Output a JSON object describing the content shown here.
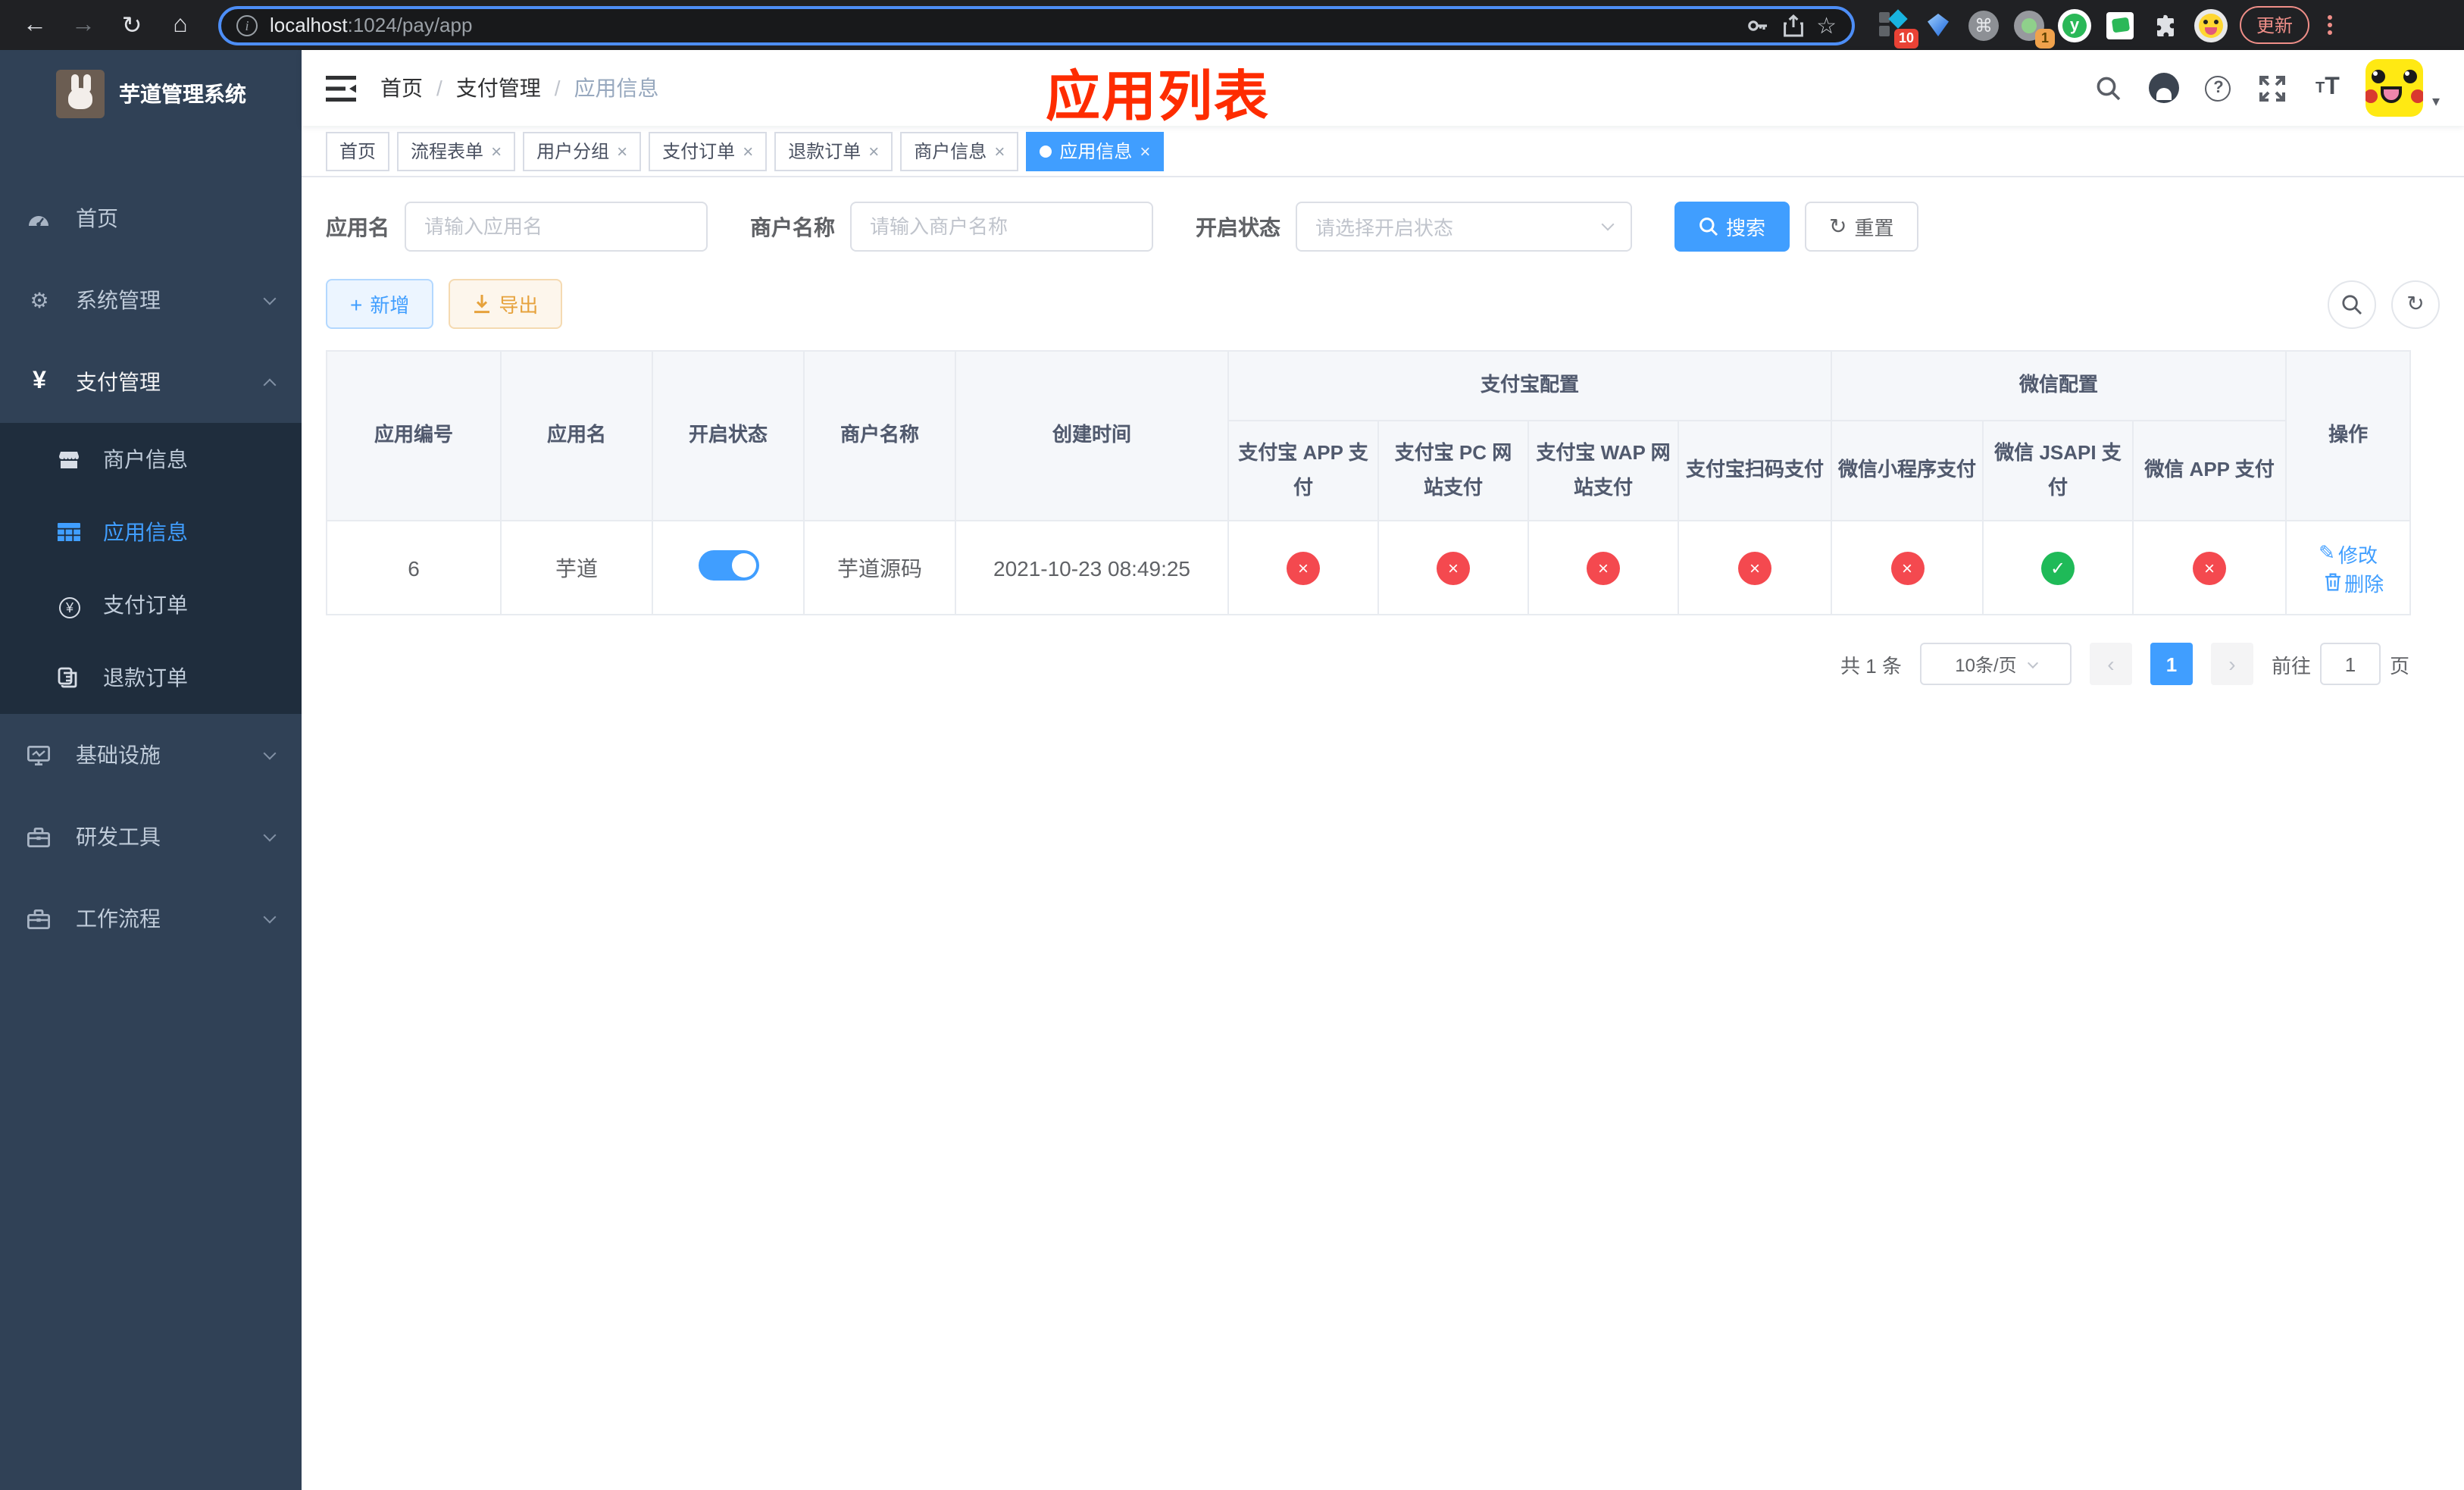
{
  "colors": {
    "primary": "#409eff",
    "danger": "#f4494f",
    "success": "#1fba58",
    "warning": "#e6a23c",
    "annotation_red": "#fe2c00",
    "sidebar_bg": "#304156",
    "submenu_bg": "#1f2d3d"
  },
  "browser": {
    "url": "localhost:1024/pay/app",
    "url_host": "localhost",
    "url_rest": ":1024/pay/app",
    "ext_badge_1": "10",
    "ext_badge_2": "1",
    "update_button": "更新"
  },
  "sidebar": {
    "title": "芋道管理系统",
    "menu": {
      "home": "首页",
      "system": "系统管理",
      "pay": "支付管理",
      "sub_merchant": "商户信息",
      "sub_app": "应用信息",
      "sub_order": "支付订单",
      "sub_refund": "退款订单",
      "infra": "基础设施",
      "dev": "研发工具",
      "flow": "工作流程"
    },
    "active_item": "应用信息"
  },
  "header": {
    "breadcrumb": [
      "首页",
      "支付管理",
      "应用信息"
    ],
    "annotation": "应用列表"
  },
  "tabs": {
    "items": [
      {
        "label": "首页",
        "closable": false,
        "active": false
      },
      {
        "label": "流程表单",
        "closable": true,
        "active": false
      },
      {
        "label": "用户分组",
        "closable": true,
        "active": false
      },
      {
        "label": "支付订单",
        "closable": true,
        "active": false
      },
      {
        "label": "退款订单",
        "closable": true,
        "active": false
      },
      {
        "label": "商户信息",
        "closable": true,
        "active": false
      },
      {
        "label": "应用信息",
        "closable": true,
        "active": true
      }
    ]
  },
  "filters": {
    "app_name_label": "应用名",
    "app_name_placeholder": "请输入应用名",
    "merchant_label": "商户名称",
    "merchant_placeholder": "请输入商户名称",
    "status_label": "开启状态",
    "status_placeholder": "请选择开启状态",
    "search": "搜索",
    "reset": "重置"
  },
  "toolbar": {
    "add": "新增",
    "export": "导出"
  },
  "table": {
    "columns": {
      "id": "应用编号",
      "name": "应用名",
      "status": "开启状态",
      "merchant": "商户名称",
      "created": "创建时间",
      "alipay_group": "支付宝配置",
      "wechat_group": "微信配置",
      "alipay_app": "支付宝 APP 支付",
      "alipay_pc": "支付宝 PC 网站支付",
      "alipay_wap": "支付宝 WAP 网站支付",
      "alipay_qr": "支付宝扫码支付",
      "wx_lite": "微信小程序支付",
      "wx_jsapi": "微信 JSAPI 支付",
      "wx_app": "微信 APP 支付",
      "actions": "操作"
    },
    "row": {
      "id": "6",
      "name": "芋道",
      "enabled": true,
      "merchant": "芋道源码",
      "created": "2021-10-23 08:49:25",
      "statuses": [
        "fail",
        "fail",
        "fail",
        "fail",
        "fail",
        "ok",
        "fail"
      ],
      "edit": "修改",
      "delete": "删除"
    }
  },
  "pagination": {
    "total": "共 1 条",
    "page_size": "10条/页",
    "page": "1",
    "goto": "前往",
    "unit": "页"
  }
}
